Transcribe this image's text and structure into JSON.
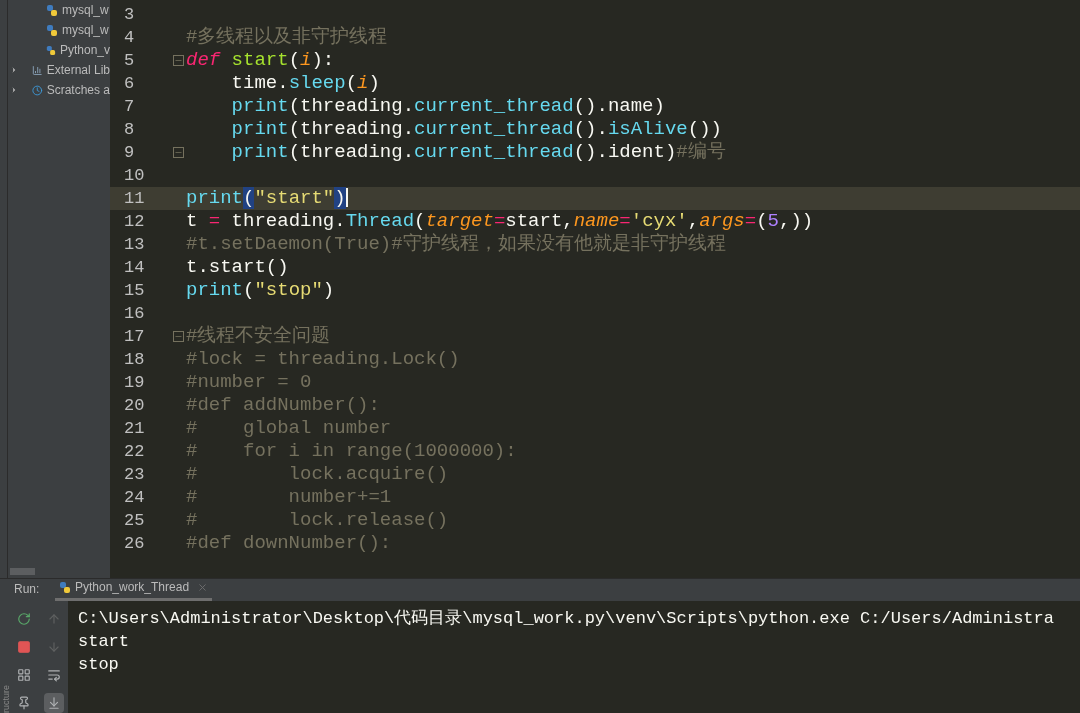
{
  "project_tree": {
    "items": [
      {
        "label": "mysql_w",
        "kind": "python",
        "expandable": false
      },
      {
        "label": "mysql_w",
        "kind": "python",
        "expandable": false
      },
      {
        "label": "Python_v",
        "kind": "python",
        "expandable": false
      },
      {
        "label": "External Lib",
        "kind": "library",
        "expandable": true
      },
      {
        "label": "Scratches a",
        "kind": "scratches",
        "expandable": true
      }
    ]
  },
  "side_strip": {
    "label": "ructure"
  },
  "editor": {
    "lines": [
      {
        "number": "3",
        "current": false,
        "fold": false
      },
      {
        "number": "4",
        "current": false,
        "fold": false,
        "tokens": [
          {
            "text": "#多线程以及非守护线程",
            "kind": "comment"
          }
        ]
      },
      {
        "number": "5",
        "current": false,
        "fold": true,
        "tokens": [
          {
            "text": "def",
            "kind": "keyword"
          },
          {
            "text": " start",
            "kind": "funcname"
          },
          {
            "text": "(",
            "kind": "plain"
          },
          {
            "text": "i",
            "kind": "param"
          },
          {
            "text": "):",
            "kind": "plain"
          }
        ]
      },
      {
        "number": "6",
        "current": false,
        "fold": false,
        "tokens": [
          {
            "text": "    time.",
            "kind": "plain"
          },
          {
            "text": "sleep",
            "kind": "call"
          },
          {
            "text": "(",
            "kind": "plain"
          },
          {
            "text": "i",
            "kind": "param"
          },
          {
            "text": ")",
            "kind": "plain"
          }
        ]
      },
      {
        "number": "7",
        "current": false,
        "fold": false,
        "tokens": [
          {
            "text": "    print",
            "kind": "call"
          },
          {
            "text": "(threading.",
            "kind": "plain"
          },
          {
            "text": "current_thread",
            "kind": "call"
          },
          {
            "text": "().name)",
            "kind": "plain"
          }
        ]
      },
      {
        "number": "8",
        "current": false,
        "fold": false,
        "tokens": [
          {
            "text": "    print",
            "kind": "call"
          },
          {
            "text": "(threading.",
            "kind": "plain"
          },
          {
            "text": "current_thread",
            "kind": "call"
          },
          {
            "text": "().",
            "kind": "plain"
          },
          {
            "text": "isAlive",
            "kind": "call"
          },
          {
            "text": "())",
            "kind": "plain"
          }
        ]
      },
      {
        "number": "9",
        "current": false,
        "fold": true,
        "tokens": [
          {
            "text": "    print",
            "kind": "call"
          },
          {
            "text": "(threading.",
            "kind": "plain"
          },
          {
            "text": "current_thread",
            "kind": "call"
          },
          {
            "text": "().ident)",
            "kind": "plain"
          },
          {
            "text": "#编号",
            "kind": "comment"
          }
        ]
      },
      {
        "number": "10",
        "current": false,
        "fold": false
      },
      {
        "number": "11",
        "current": true,
        "fold": false,
        "tokens": [
          {
            "text": "print",
            "kind": "call"
          },
          {
            "text": "(",
            "kind": "match"
          },
          {
            "text": "\"start\"",
            "kind": "string"
          },
          {
            "text": ")",
            "kind": "match"
          }
        ]
      },
      {
        "number": "12",
        "current": false,
        "fold": false,
        "tokens": [
          {
            "text": "t ",
            "kind": "plain"
          },
          {
            "text": "=",
            "kind": "operator"
          },
          {
            "text": " threading.",
            "kind": "plain"
          },
          {
            "text": "Thread",
            "kind": "call"
          },
          {
            "text": "(",
            "kind": "plain"
          },
          {
            "text": "target",
            "kind": "param"
          },
          {
            "text": "=",
            "kind": "operator"
          },
          {
            "text": "start,",
            "kind": "plain"
          },
          {
            "text": "name",
            "kind": "param"
          },
          {
            "text": "=",
            "kind": "operator"
          },
          {
            "text": "'cyx'",
            "kind": "string"
          },
          {
            "text": ",",
            "kind": "plain"
          },
          {
            "text": "args",
            "kind": "param"
          },
          {
            "text": "=",
            "kind": "operator"
          },
          {
            "text": "(",
            "kind": "plain"
          },
          {
            "text": "5",
            "kind": "number"
          },
          {
            "text": ",))",
            "kind": "plain"
          }
        ]
      },
      {
        "number": "13",
        "current": false,
        "fold": false,
        "tokens": [
          {
            "text": "#t.setDaemon(True)#守护线程，如果没有他就是非守护线程",
            "kind": "comment"
          }
        ]
      },
      {
        "number": "14",
        "current": false,
        "fold": false,
        "tokens": [
          {
            "text": "t.start()",
            "kind": "plain"
          }
        ]
      },
      {
        "number": "15",
        "current": false,
        "fold": false,
        "tokens": [
          {
            "text": "print",
            "kind": "call"
          },
          {
            "text": "(",
            "kind": "plain"
          },
          {
            "text": "\"stop\"",
            "kind": "string"
          },
          {
            "text": ")",
            "kind": "plain"
          }
        ]
      },
      {
        "number": "16",
        "current": false,
        "fold": false
      },
      {
        "number": "17",
        "current": false,
        "fold": true,
        "tokens": [
          {
            "text": "#线程不安全问题",
            "kind": "comment"
          }
        ]
      },
      {
        "number": "18",
        "current": false,
        "fold": false,
        "tokens": [
          {
            "text": "#lock = threading.Lock()",
            "kind": "comment"
          }
        ]
      },
      {
        "number": "19",
        "current": false,
        "fold": false,
        "tokens": [
          {
            "text": "#number = 0",
            "kind": "comment"
          }
        ]
      },
      {
        "number": "20",
        "current": false,
        "fold": false,
        "tokens": [
          {
            "text": "#def addNumber():",
            "kind": "comment"
          }
        ]
      },
      {
        "number": "21",
        "current": false,
        "fold": false,
        "tokens": [
          {
            "text": "#    global number",
            "kind": "comment"
          }
        ]
      },
      {
        "number": "22",
        "current": false,
        "fold": false,
        "tokens": [
          {
            "text": "#    for i in range(1000000):",
            "kind": "comment"
          }
        ]
      },
      {
        "number": "23",
        "current": false,
        "fold": false,
        "tokens": [
          {
            "text": "#        lock.acquire()",
            "kind": "comment"
          }
        ]
      },
      {
        "number": "24",
        "current": false,
        "fold": false,
        "tokens": [
          {
            "text": "#        number+=1",
            "kind": "comment"
          }
        ]
      },
      {
        "number": "25",
        "current": false,
        "fold": false,
        "tokens": [
          {
            "text": "#        lock.release()",
            "kind": "comment"
          }
        ]
      },
      {
        "number": "26",
        "current": false,
        "fold": false,
        "tokens": [
          {
            "text": "#def downNumber():",
            "kind": "comment"
          }
        ]
      }
    ]
  },
  "run_panel": {
    "label": "Run:",
    "tabs": [
      {
        "label": "Python_work_Thread",
        "selected": true
      }
    ],
    "tools": [
      {
        "kind": "rerun",
        "selected": false
      },
      {
        "kind": "up",
        "selected": false
      },
      {
        "kind": "stop",
        "selected": false
      },
      {
        "kind": "down",
        "selected": false
      },
      {
        "kind": "layout",
        "selected": false
      },
      {
        "kind": "wrap",
        "selected": false
      },
      {
        "kind": "pin",
        "selected": false
      },
      {
        "kind": "scroll-end",
        "selected": true
      }
    ],
    "output": [
      "C:\\Users\\Administrator\\Desktop\\代码目录\\mysql_work.py\\venv\\Scripts\\python.exe C:/Users/Administra",
      "start",
      "stop"
    ]
  }
}
